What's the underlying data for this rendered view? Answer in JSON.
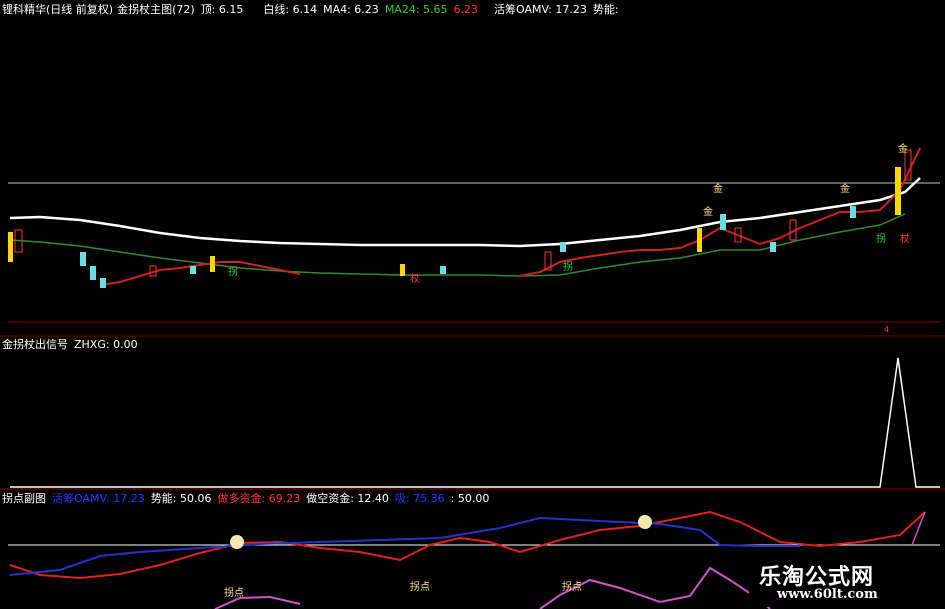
{
  "main": {
    "title": "锂科精华(日线 前复权)",
    "indicator": "金拐杖主图(72)",
    "fields": [
      {
        "label": "顶: 6.15",
        "color": "#ffffff"
      },
      {
        "label": "白线: 6.14",
        "color": "#ffffff"
      },
      {
        "label": "MA4: 6.23",
        "color": "#ffffff"
      },
      {
        "label": "MA24: 5.65",
        "color": "#33cc33"
      },
      {
        "label": "6.23",
        "color": "#ff3333"
      },
      {
        "label": "活筹OAMV: 17.23",
        "color": "#ffffff"
      },
      {
        "label": "势能:",
        "color": "#ffffff"
      }
    ],
    "markers": {
      "gold": "金",
      "crutch": "拐",
      "stick": "杖",
      "small": "4"
    }
  },
  "signal": {
    "title": "金拐杖出信号",
    "field": "ZHXG: 0.00"
  },
  "sub": {
    "title": "拐点副图",
    "fields": [
      {
        "label": "活筹OAMV: 17.23",
        "color": "#3333ff"
      },
      {
        "label": "势能: 50.06",
        "color": "#ffffff"
      },
      {
        "label": "做多资金: 69.23",
        "color": "#ff3333"
      },
      {
        "label": "做空资金: 12.40",
        "color": "#ffffff"
      },
      {
        "label": "吸: 75.36",
        "color": "#3333ff"
      },
      {
        "label": ": 50.00",
        "color": "#ffffff"
      }
    ],
    "turn_label": "拐点"
  },
  "watermark": {
    "line1": "乐淘公式网",
    "line2": "www.60lt.com"
  }
}
